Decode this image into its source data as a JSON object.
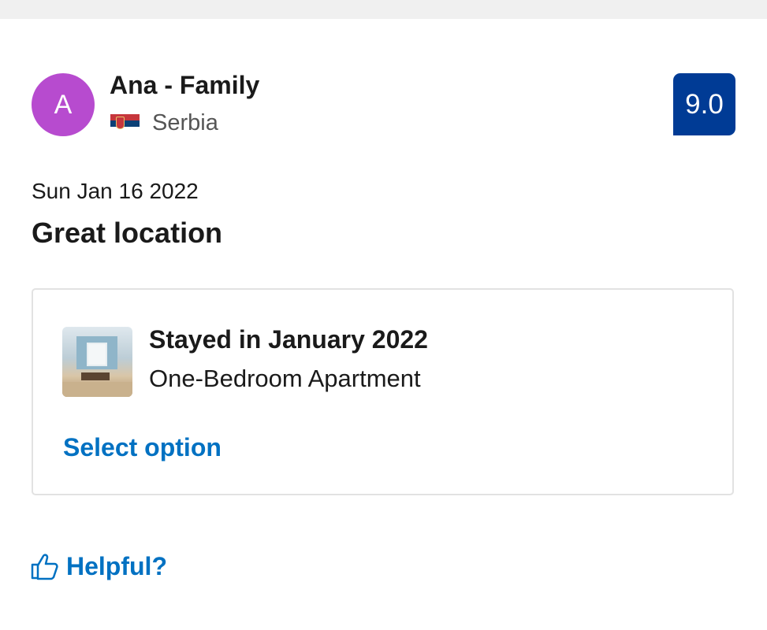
{
  "reviewer": {
    "initial": "A",
    "name": "Ana - Family",
    "country": "Serbia",
    "avatar_color": "#b74bcf",
    "flag_icon": "serbia-flag-icon"
  },
  "score": {
    "value": "9.0",
    "color": "#003b95"
  },
  "review": {
    "date": "Sun Jan 16 2022",
    "title": "Great location"
  },
  "stay": {
    "period": "Stayed in January 2022",
    "room": "One-Bedroom Apartment",
    "select_label": "Select option",
    "thumbnail_icon": "room-photo-thumbnail"
  },
  "helpful": {
    "label": "Helpful?",
    "icon": "thumbs-up-icon"
  },
  "colors": {
    "link": "#0071c2",
    "text": "#1a1a1a",
    "muted": "#555555",
    "card_border": "#e2e2e2"
  }
}
